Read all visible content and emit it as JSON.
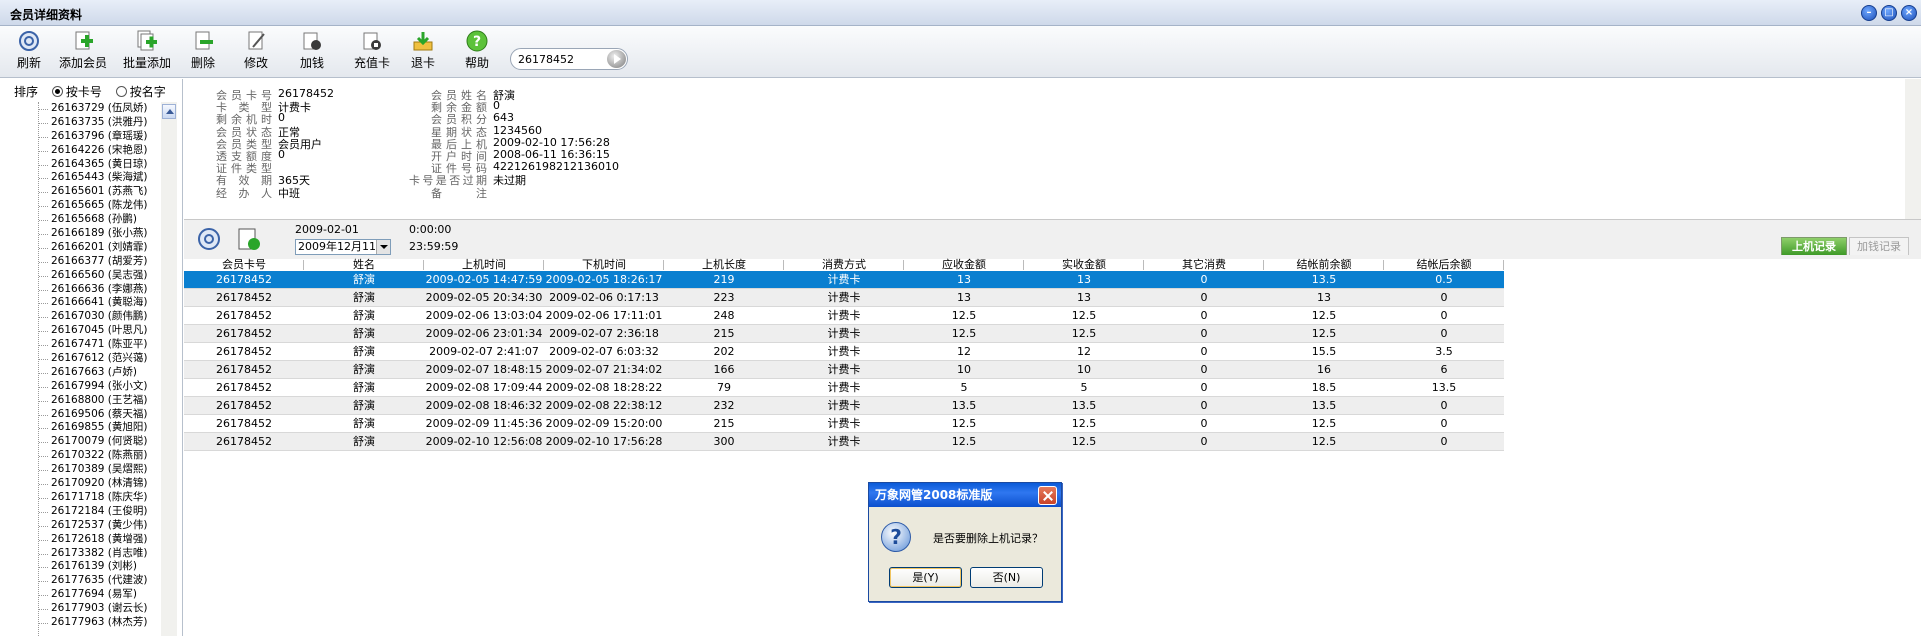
{
  "window": {
    "title": "会员详细资料"
  },
  "toolbar": {
    "buttons": [
      {
        "label": "刷新",
        "icon": "refresh-icon"
      },
      {
        "label": "添加会员",
        "icon": "add-member-icon"
      },
      {
        "label": "批量添加",
        "icon": "batch-add-icon"
      },
      {
        "label": "删除",
        "icon": "delete-icon"
      },
      {
        "label": "修改",
        "icon": "edit-icon"
      },
      {
        "label": "加钱",
        "icon": "add-money-icon"
      },
      {
        "label": "充值卡",
        "icon": "recharge-card-icon"
      },
      {
        "label": "退卡",
        "icon": "return-card-icon"
      },
      {
        "label": "帮助",
        "icon": "help-icon"
      }
    ],
    "search_value": "26178452"
  },
  "sidebar": {
    "sort_label": "排序",
    "sort_options": [
      {
        "label": "按卡号",
        "selected": true
      },
      {
        "label": "按名字",
        "selected": false
      }
    ],
    "members": [
      "26163729 (伍凤娇)",
      "26163735 (洪雅丹)",
      "26163796 (章瑶瑗)",
      "26164226 (宋艳恩)",
      "26164365 (黄日琼)",
      "26165443 (柴海斌)",
      "26165601 (苏燕飞)",
      "26165665 (陈龙伟)",
      "26165668 (孙鹏)",
      "26166189 (张小燕)",
      "26166201 (刘婧霏)",
      "26166377 (胡爱芳)",
      "26166560 (吴志强)",
      "26166636 (李娜燕)",
      "26166641 (黄聪海)",
      "26167030 (颜伟鹏)",
      "26167045 (叶思凡)",
      "26167471 (陈亚平)",
      "26167612 (范兴蔼)",
      "26167663 (卢娇)",
      "26167994 (张小文)",
      "26168800 (王艺福)",
      "26169506 (蔡天福)",
      "26169855 (黄旭阳)",
      "26170079 (何贤聪)",
      "26170322 (陈燕丽)",
      "26170389 (吴熠熙)",
      "26170920 (林清锦)",
      "26171718 (陈庆华)",
      "26172184 (王俊明)",
      "26172537 (黄少伟)",
      "26172618 (黄增强)",
      "26173382 (肖志唯)",
      "26176139 (刘彬)",
      "26177635 (代建波)",
      "26177694 (易军)",
      "26177903 (谢云长)",
      "26177963 (林杰芳)"
    ]
  },
  "info": {
    "left": [
      {
        "k": "会员卡号",
        "v": "26178452"
      },
      {
        "k": "卡 类 型",
        "v": "计费卡"
      },
      {
        "k": "剩余机时",
        "v": "0"
      },
      {
        "k": "会员状态",
        "v": "正常"
      },
      {
        "k": "会员类型",
        "v": "会员用户"
      },
      {
        "k": "透支额度",
        "v": "0"
      },
      {
        "k": "证件类型",
        "v": ""
      },
      {
        "k": "有 效 期",
        "v": "365天"
      },
      {
        "k": "经 办 人",
        "v": "中班"
      }
    ],
    "right": [
      {
        "k": "会员姓名",
        "v": "舒演"
      },
      {
        "k": "剩余金额",
        "v": "0"
      },
      {
        "k": "会员积分",
        "v": "643"
      },
      {
        "k": "星期状态",
        "v": "1234560"
      },
      {
        "k": "最后上机",
        "v": "2009-02-10 17:56:28"
      },
      {
        "k": "开户时间",
        "v": "2008-06-11 16:36:15"
      },
      {
        "k": "证件号码",
        "v": "422126198212136010"
      },
      {
        "k": "卡号是否过期",
        "v": "未过期"
      },
      {
        "k": "备　　注",
        "v": ""
      }
    ]
  },
  "datebar": {
    "start_date": "2009-02-01",
    "start_time": "0:00:00",
    "end_date": "2009年12月11日",
    "end_time": "23:59:59"
  },
  "tabs": {
    "logon": "上机记录",
    "recharge": "加钱记录"
  },
  "grid": {
    "columns": [
      "会员卡号",
      "姓名",
      "上机时间",
      "下机时间",
      "上机长度",
      "消费方式",
      "应收金额",
      "实收金额",
      "其它消费",
      "结帐前余额",
      "结帐后余额"
    ],
    "rows": [
      [
        "26178452",
        "舒演",
        "2009-02-05 14:47:59",
        "2009-02-05 18:26:17",
        "219",
        "计费卡",
        "13",
        "13",
        "0",
        "13.5",
        "0.5"
      ],
      [
        "26178452",
        "舒演",
        "2009-02-05 20:34:30",
        "2009-02-06 0:17:13",
        "223",
        "计费卡",
        "13",
        "13",
        "0",
        "13",
        "0"
      ],
      [
        "26178452",
        "舒演",
        "2009-02-06 13:03:04",
        "2009-02-06 17:11:01",
        "248",
        "计费卡",
        "12.5",
        "12.5",
        "0",
        "12.5",
        "0"
      ],
      [
        "26178452",
        "舒演",
        "2009-02-06 23:01:34",
        "2009-02-07 2:36:18",
        "215",
        "计费卡",
        "12.5",
        "12.5",
        "0",
        "12.5",
        "0"
      ],
      [
        "26178452",
        "舒演",
        "2009-02-07 2:41:07",
        "2009-02-07 6:03:32",
        "202",
        "计费卡",
        "12",
        "12",
        "0",
        "15.5",
        "3.5"
      ],
      [
        "26178452",
        "舒演",
        "2009-02-07 18:48:15",
        "2009-02-07 21:34:02",
        "166",
        "计费卡",
        "10",
        "10",
        "0",
        "16",
        "6"
      ],
      [
        "26178452",
        "舒演",
        "2009-02-08 17:09:44",
        "2009-02-08 18:28:22",
        "79",
        "计费卡",
        "5",
        "5",
        "0",
        "18.5",
        "13.5"
      ],
      [
        "26178452",
        "舒演",
        "2009-02-08 18:46:32",
        "2009-02-08 22:38:12",
        "232",
        "计费卡",
        "13.5",
        "13.5",
        "0",
        "13.5",
        "0"
      ],
      [
        "26178452",
        "舒演",
        "2009-02-09 11:45:36",
        "2009-02-09 15:20:00",
        "215",
        "计费卡",
        "12.5",
        "12.5",
        "0",
        "12.5",
        "0"
      ],
      [
        "26178452",
        "舒演",
        "2009-02-10 12:56:08",
        "2009-02-10 17:56:28",
        "300",
        "计费卡",
        "12.5",
        "12.5",
        "0",
        "12.5",
        "0"
      ]
    ]
  },
  "dialog": {
    "title": "万象网管2008标准版",
    "message": "是否要删除上机记录？",
    "yes": "是(Y)",
    "no": "否(N)"
  }
}
